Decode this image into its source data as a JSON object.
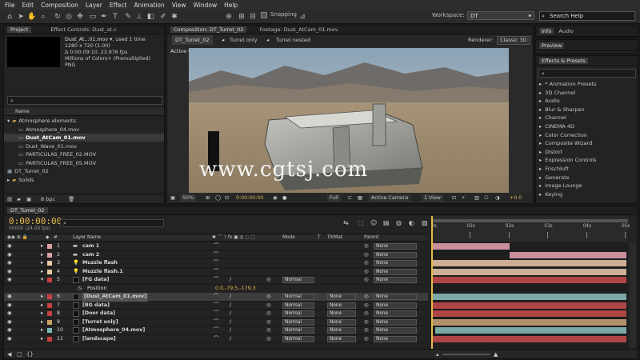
{
  "menu": [
    "File",
    "Edit",
    "Composition",
    "Layer",
    "Effect",
    "Animation",
    "View",
    "Window",
    "Help"
  ],
  "toolbar": {
    "snapping": "Snapping",
    "workspace_label": "Workspace:",
    "workspace_value": "DT",
    "search_placeholder": "Search Help"
  },
  "project": {
    "tab1": "Project",
    "tab2": "Effect Controls: Dust_at.c",
    "item_name": "Dust_At...01.mov ▾",
    "item_used": ", used 1 time",
    "info1": "1280 x 720 (1.00)",
    "info2": "Δ 0:00:09:10, 23.976 fps",
    "info3": "Millions of Colors+ (Premultiplied)",
    "info4": "PNG",
    "col_name": "Name",
    "search_icon": "⌕",
    "bpc": "8 bpc",
    "tree": [
      {
        "label": "Atmosphere elements",
        "indent": 0,
        "type": "folder",
        "open": true
      },
      {
        "label": "Atmosphere_04.mov",
        "indent": 1,
        "type": "file"
      },
      {
        "label": "Dust_AtCam_01.mov",
        "indent": 1,
        "type": "file",
        "selected": true
      },
      {
        "label": "Dust_Wave_01.mov",
        "indent": 1,
        "type": "file"
      },
      {
        "label": "PARTICULAS_FREE_02.MOV",
        "indent": 1,
        "type": "file"
      },
      {
        "label": "PARTICULAS_FREE_05.MOV",
        "indent": 1,
        "type": "file"
      },
      {
        "label": "DT_Turret_02",
        "indent": 0,
        "type": "comp"
      },
      {
        "label": "Solids",
        "indent": 0,
        "type": "folder"
      }
    ]
  },
  "composition": {
    "tab": "Composition: DT_Turret_02",
    "tab2": "Footage: Dust_AtCam_01.mov",
    "sub_tab1": "DT_Turret_02",
    "sub_tab2": "Turret only",
    "sub_tab3": "Turret nested",
    "renderer_label": "Renderer:",
    "renderer_value": "Classic 3D",
    "active_camera": "Active Camera",
    "zoom": "50%",
    "timecode": "0:00:00:00",
    "resolution": "Full",
    "view": "Active Camera",
    "views": "1 View",
    "exposure": "+0.0",
    "watermark": "www.cgtsj.com"
  },
  "right": {
    "info_tab": "Info",
    "audio_tab": "Audio",
    "preview_tab": "Preview",
    "effects_tab": "Effects & Presets",
    "effects": [
      "* Animation Presets",
      "3D Channel",
      "Audio",
      "Blur & Sharpen",
      "Channel",
      "CINEMA 4D",
      "Color Correction",
      "Composite Wizard",
      "Distort",
      "Expression Controls",
      "Frischluft",
      "Generate",
      "Image Lounge",
      "Keying"
    ]
  },
  "timeline": {
    "tab": "DT_Turret_02",
    "timecode": "0:00:00:00",
    "fps": "00000 (24.00 fps)",
    "col_layer": "Layer Name",
    "col_mode": "Mode",
    "col_t": "T",
    "col_trkmat": "TrkMat",
    "col_parent": "Parent",
    "ruler": [
      "0s",
      "01s",
      "02s",
      "03s",
      "04s",
      "05s"
    ],
    "position_label": "Position",
    "position_value": "0.0,-79.5,-179.3",
    "layers": [
      {
        "num": "1",
        "name": "cam 1",
        "color": "#d9a0a8",
        "mode": "",
        "trk": "",
        "parent": "None",
        "bar_color": "#c98f9b",
        "bar_start": 0,
        "bar_end": 0.4
      },
      {
        "num": "2",
        "name": "cam 2",
        "color": "#d9a0a8",
        "mode": "",
        "trk": "",
        "parent": "None",
        "bar_color": "#c98f9b",
        "bar_start": 0.4,
        "bar_end": 1
      },
      {
        "num": "3",
        "name": "Muzzle flash",
        "color": "#e6c9a0",
        "mode": "",
        "trk": "",
        "parent": "None",
        "bar_color": "#cbae93",
        "bar_start": 0,
        "bar_end": 1
      },
      {
        "num": "4",
        "name": "Muzzle flash.1",
        "color": "#e6c9a0",
        "mode": "",
        "trk": "",
        "parent": "None",
        "bar_color": "#cbae93",
        "bar_start": 0,
        "bar_end": 1
      },
      {
        "num": "5",
        "name": "[FG data]",
        "color": "#c94040",
        "mode": "Normal",
        "trk": "",
        "parent": "None",
        "bar_color": "#b04545",
        "bar_start": 0,
        "bar_end": 1,
        "open": true
      },
      {
        "num": "6",
        "name": "[Dust_AtCam_01.mov]",
        "color": "#c94040",
        "mode": "Normal",
        "trk": "None",
        "parent": "None",
        "bar_color": "#7aa9a6",
        "bar_start": 0,
        "bar_end": 1,
        "selected": true
      },
      {
        "num": "7",
        "name": "[BG data]",
        "color": "#c94040",
        "mode": "Normal",
        "trk": "None",
        "parent": "None",
        "bar_color": "#b04545",
        "bar_start": 0,
        "bar_end": 1
      },
      {
        "num": "8",
        "name": "[Door data]",
        "color": "#c94040",
        "mode": "Normal",
        "trk": "None",
        "parent": "None",
        "bar_color": "#b04545",
        "bar_start": 0,
        "bar_end": 1
      },
      {
        "num": "9",
        "name": "[Turret only]",
        "color": "#c9a060",
        "mode": "Normal",
        "trk": "None",
        "parent": "None",
        "bar_color": "#b2926a",
        "bar_start": 0,
        "bar_end": 1
      },
      {
        "num": "10",
        "name": "[Atmosphere_04.mov]",
        "color": "#7ab8b4",
        "mode": "Normal",
        "trk": "None",
        "parent": "None",
        "bar_color": "#7aa9a6",
        "bar_start": 0.02,
        "bar_end": 1
      },
      {
        "num": "11",
        "name": "[landscape]",
        "color": "#c94040",
        "mode": "Normal",
        "trk": "None",
        "parent": "None",
        "bar_color": "#b04545",
        "bar_start": 0,
        "bar_end": 1
      }
    ]
  }
}
